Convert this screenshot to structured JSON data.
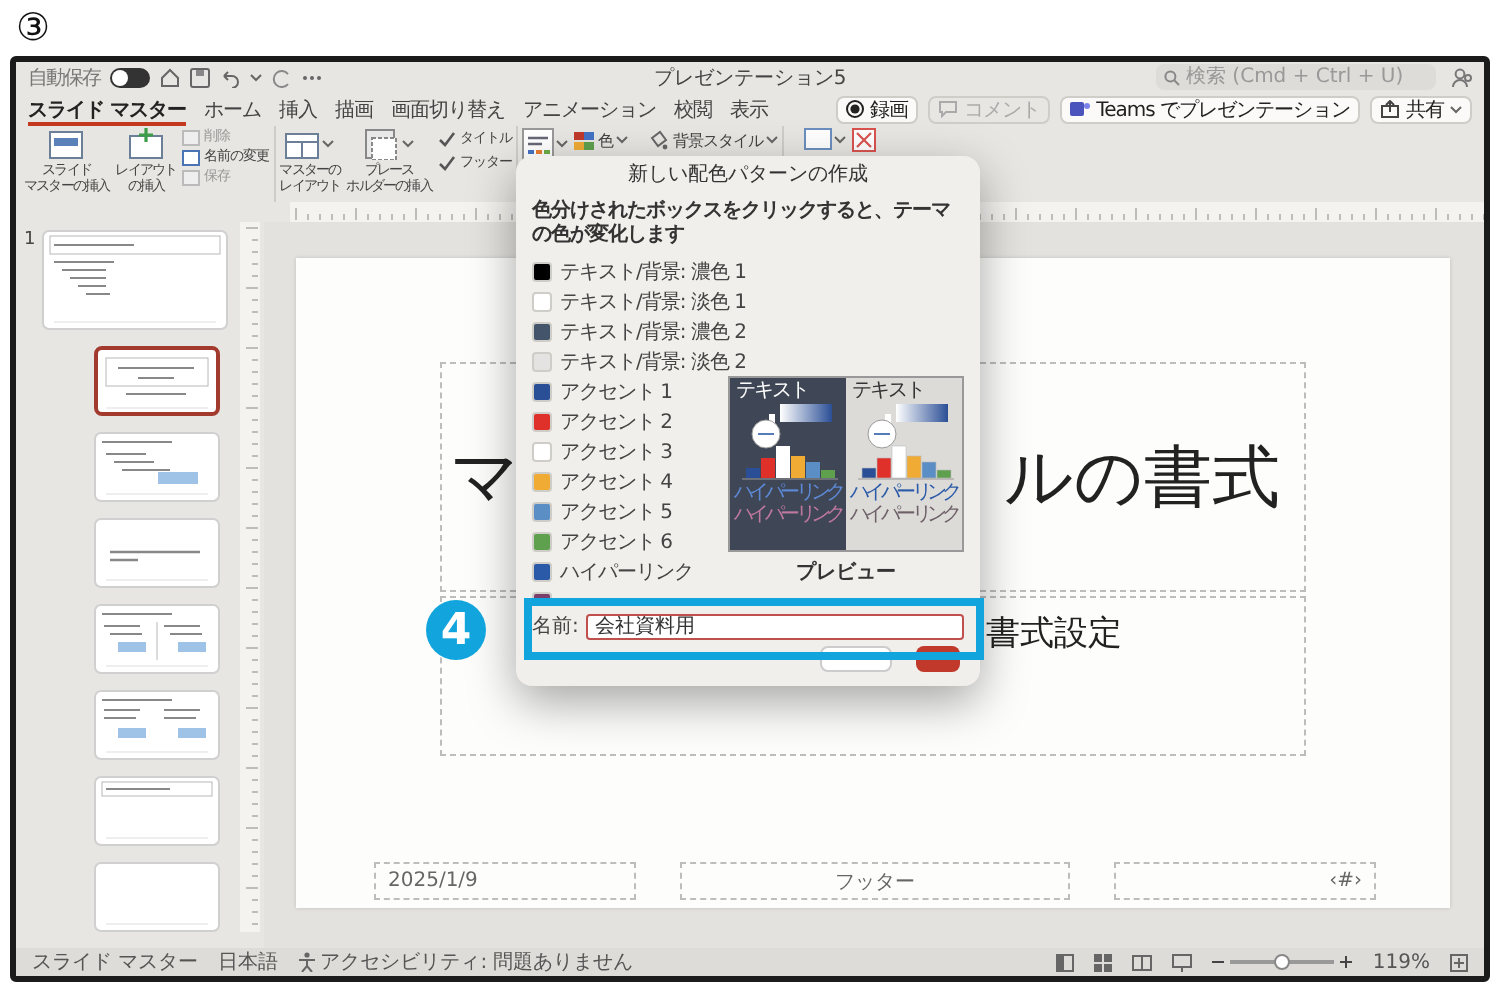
{
  "step_marker": "③",
  "window": {
    "title": "プレゼンテーション5",
    "autosave": {
      "label": "自動保存",
      "on": false
    },
    "search": {
      "placeholder": "検索 (Cmd + Ctrl + U)"
    }
  },
  "tabs": [
    {
      "label": "スライド マスター",
      "selected": true
    },
    {
      "label": "ホーム",
      "selected": false
    },
    {
      "label": "挿入",
      "selected": false
    },
    {
      "label": "描画",
      "selected": false
    },
    {
      "label": "画面切り替え",
      "selected": false
    },
    {
      "label": "アニメーション",
      "selected": false
    },
    {
      "label": "校閲",
      "selected": false
    },
    {
      "label": "表示",
      "selected": false
    }
  ],
  "actions": [
    {
      "kind": "record",
      "label": "録画",
      "disabled": false
    },
    {
      "kind": "comment",
      "label": "コメント",
      "disabled": true
    },
    {
      "kind": "teams",
      "label": "Teams でプレゼンテーション",
      "disabled": false
    },
    {
      "kind": "share",
      "label": "共有",
      "disabled": false
    }
  ],
  "ribbon": [
    {
      "items": [
        {
          "kind": "large",
          "lines": [
            "スライド",
            "マスターの挿入"
          ]
        },
        {
          "kind": "large",
          "lines": [
            "レイアウト",
            "の挿入"
          ]
        },
        {
          "kind": "stack",
          "items": [
            {
              "label": "削除",
              "disabled": true
            },
            {
              "label": "名前の変更",
              "disabled": false
            },
            {
              "label": "保存",
              "disabled": true
            }
          ]
        }
      ]
    },
    {
      "items": [
        {
          "kind": "large",
          "lines": [
            "マスターの",
            "レイアウト"
          ]
        },
        {
          "kind": "large",
          "lines": [
            "プレース",
            "ホルダーの挿入"
          ]
        },
        {
          "kind": "checks",
          "items": [
            {
              "label": "タイトル",
              "checked": true
            },
            {
              "label": "フッター",
              "checked": true
            }
          ]
        }
      ]
    },
    {
      "items": [
        {
          "kind": "theme"
        },
        {
          "kind": "dropdowns",
          "items": [
            {
              "label": "色"
            },
            {
              "label": "背景スタイル"
            }
          ]
        }
      ]
    },
    {
      "items": [
        {
          "kind": "tool"
        },
        {
          "kind": "tool"
        }
      ]
    }
  ],
  "slide_panel": {
    "slide_number": "1",
    "thumbnails": [
      {
        "kind": "master",
        "selected": false
      },
      {
        "kind": "title",
        "selected": true
      },
      {
        "kind": "content",
        "selected": false
      },
      {
        "kind": "section",
        "selected": false
      },
      {
        "kind": "two_content",
        "selected": false
      },
      {
        "kind": "comparison",
        "selected": false
      },
      {
        "kind": "title_only",
        "selected": false
      },
      {
        "kind": "blank",
        "selected": false
      }
    ]
  },
  "slide": {
    "title_parts": [
      "マ",
      "ルの書式"
    ],
    "subtitle_part": "書式設定",
    "footer": {
      "date": "2025/1/9",
      "text": "フッター",
      "number": "‹#›"
    }
  },
  "dialog": {
    "title": "新しい配色パターンの作成",
    "instruction": "色分けされたボックスをクリックすると、テーマの色が変化します",
    "colors": [
      {
        "label": "テキスト/背景: 濃色 1",
        "color": "#000000"
      },
      {
        "label": "テキスト/背景: 淡色 1",
        "color": "#ffffff"
      },
      {
        "label": "テキスト/背景: 濃色 2",
        "color": "#44546a"
      },
      {
        "label": "テキスト/背景: 淡色 2",
        "color": "#e4e3e1"
      },
      {
        "label": "アクセント 1",
        "color": "#2b4f96"
      },
      {
        "label": "アクセント 2",
        "color": "#e0302a"
      },
      {
        "label": "アクセント 3",
        "color": "#ffffff"
      },
      {
        "label": "アクセント 4",
        "color": "#f0ab35"
      },
      {
        "label": "アクセント 5",
        "color": "#5b8ec4"
      },
      {
        "label": "アクセント 6",
        "color": "#5fa04e"
      },
      {
        "label": "ハイパーリンク",
        "color": "#2b5aa8"
      },
      {
        "color": "#7b3f6a"
      }
    ],
    "preview": {
      "label": "プレビュー",
      "panels": [
        {
          "kind": "dark",
          "heading": "テキスト",
          "links": [
            {
              "text": "ハイパーリンク",
              "color": "#5d8ad6"
            },
            {
              "text": "ハイパーリンク",
              "color": "#c0789f"
            }
          ]
        },
        {
          "kind": "light",
          "heading": "テキスト",
          "links": [
            {
              "text": "ハイパーリンク",
              "color": "#2b5aa8"
            },
            {
              "text": "ハイパーリンク",
              "color": "#6e6068"
            }
          ]
        }
      ]
    },
    "name_field": {
      "label": "名前:",
      "value": "会社資料用"
    }
  },
  "callout": {
    "number": "4"
  },
  "status_bar": {
    "items": [
      "スライド マスター",
      "日本語",
      "アクセシビリティ: 問題ありません"
    ],
    "zoom": {
      "level": 0.5,
      "reading": "119%"
    }
  }
}
